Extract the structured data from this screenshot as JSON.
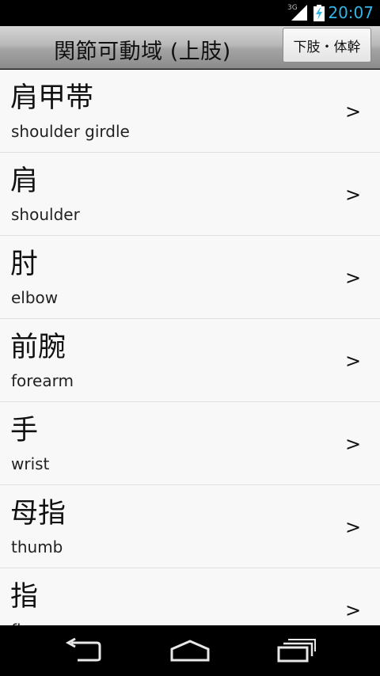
{
  "status_bar": {
    "network": "3G",
    "clock": "20:07",
    "accent_color": "#33b5e5"
  },
  "header": {
    "title": "関節可動域 (上肢)",
    "switch_button_label": "下肢・体幹"
  },
  "list": {
    "items": [
      {
        "jp": "肩甲帯",
        "en": "shoulder girdle",
        "arrow": ">"
      },
      {
        "jp": "肩",
        "en": "shoulder",
        "arrow": ">"
      },
      {
        "jp": "肘",
        "en": "elbow",
        "arrow": ">"
      },
      {
        "jp": "前腕",
        "en": "forearm",
        "arrow": ">"
      },
      {
        "jp": "手",
        "en": "wrist",
        "arrow": ">"
      },
      {
        "jp": "母指",
        "en": "thumb",
        "arrow": ">"
      },
      {
        "jp": "指",
        "en": "finger",
        "arrow": ">"
      }
    ]
  },
  "nav_bar": {
    "icons": [
      "back-icon",
      "home-icon",
      "recent-apps-icon"
    ]
  }
}
